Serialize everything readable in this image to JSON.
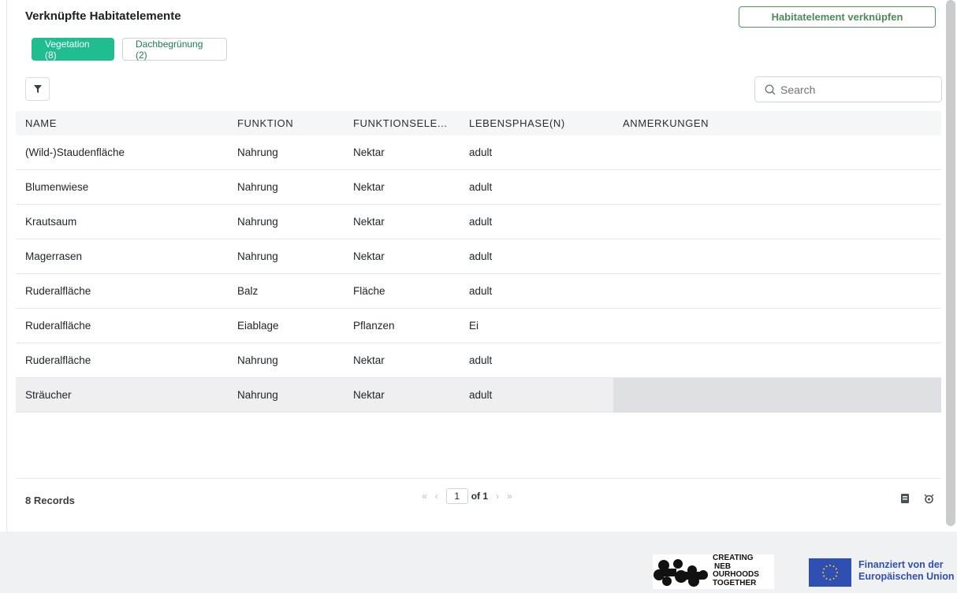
{
  "header": {
    "title": "Verknüpfte Habitatelemente",
    "link_button": "Habitatelement verknüpfen"
  },
  "tabs": [
    {
      "label": "Vegetation (8)",
      "active": true
    },
    {
      "label": "Dachbegrünung (2)",
      "active": false
    }
  ],
  "search": {
    "placeholder": "Search"
  },
  "table": {
    "columns": [
      "NAME",
      "FUNKTION",
      "FUNKTIONSELE...",
      "LEBENSPHASE(N)",
      "ANMERKUNGEN"
    ],
    "rows": [
      [
        "(Wild-)Staudenfläche",
        "Nahrung",
        "Nektar",
        "adult",
        ""
      ],
      [
        "Blumenwiese",
        "Nahrung",
        "Nektar",
        "adult",
        ""
      ],
      [
        "Krautsaum",
        "Nahrung",
        "Nektar",
        "adult",
        ""
      ],
      [
        "Magerrasen",
        "Nahrung",
        "Nektar",
        "adult",
        ""
      ],
      [
        "Ruderalfläche",
        "Balz",
        "Fläche",
        "adult",
        ""
      ],
      [
        "Ruderalfläche",
        "Eiablage",
        "Pflanzen",
        "Ei",
        ""
      ],
      [
        "Ruderalfläche",
        "Nahrung",
        "Nektar",
        "adult",
        ""
      ],
      [
        "Sträucher",
        "Nahrung",
        "Nektar",
        "adult",
        ""
      ]
    ],
    "selected_row": 7
  },
  "footer": {
    "records": "8 Records",
    "first": "«",
    "prev": "‹",
    "page": "1",
    "of": "of 1",
    "next": "›",
    "last": "»"
  },
  "branding": {
    "cnot_l1": "CREATING",
    "cnot_l2": "NEB",
    "cnot_l3": "OURHOODS",
    "cnot_l4": "TOGETHER",
    "eu_l1": "Finanziert von der",
    "eu_l2": "Europäischen Union"
  },
  "colors": {
    "accent": "#1fbd8f",
    "link_green": "#4d8a57",
    "eu_blue": "#2f4fb2"
  }
}
